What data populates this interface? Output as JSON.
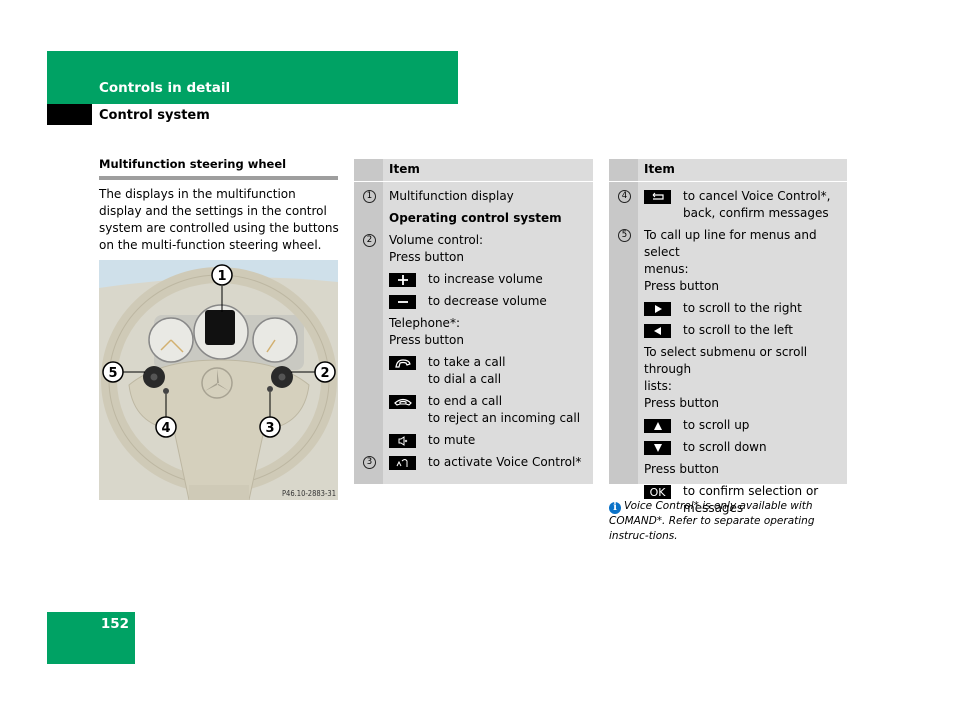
{
  "header": {
    "section_title": "Controls in detail",
    "subsection_title": "Control system"
  },
  "left": {
    "heading": "Multifunction steering wheel",
    "intro": "The displays in the multifunction display and the settings in the control system are controlled using the buttons on the multi-function steering wheel.",
    "figure": {
      "code": "P46.10-2883-31",
      "callouts": [
        "1",
        "2",
        "3",
        "4",
        "5"
      ]
    }
  },
  "table1": {
    "header": "Item",
    "rows": [
      {
        "num": "1",
        "text": "Multifunction display"
      },
      {
        "text": "Operating control system",
        "bold": true
      },
      {
        "num": "2",
        "lines": [
          "Volume control:",
          "Press button"
        ]
      },
      {
        "icon": "plus-key",
        "text": "to increase volume"
      },
      {
        "icon": "minus-key",
        "text": "to decrease volume"
      },
      {
        "lines": [
          "Telephone*:",
          "Press button"
        ]
      },
      {
        "icon": "phone-pickup-key",
        "lines": [
          "to take a call",
          "to dial a call"
        ]
      },
      {
        "icon": "phone-hangup-key",
        "lines": [
          "to end a call",
          "to reject an incoming call"
        ]
      },
      {
        "icon": "mute-key",
        "text": "to mute"
      },
      {
        "num": "3",
        "icon": "voice-control-key",
        "text": "to activate Voice Control*"
      }
    ]
  },
  "table2": {
    "header": "Item",
    "rows": [
      {
        "num": "4",
        "icon": "back-key",
        "lines": [
          "to cancel Voice Control*,",
          "back, confirm messages"
        ]
      },
      {
        "num": "5",
        "lines": [
          "To call up line for menus and select",
          "menus:",
          "Press button"
        ]
      },
      {
        "icon": "right-arrow-key",
        "text": "to scroll to the right"
      },
      {
        "icon": "left-arrow-key",
        "text": "to scroll to the left"
      },
      {
        "lines": [
          "To select submenu or scroll through",
          "lists:",
          "Press button"
        ]
      },
      {
        "icon": "up-arrow-key",
        "text": "to scroll up"
      },
      {
        "icon": "down-arrow-key",
        "text": "to scroll down"
      },
      {
        "text": "Press button"
      },
      {
        "icon": "ok-key",
        "key_label": "OK",
        "lines": [
          "to confirm selection or",
          "messages"
        ]
      }
    ]
  },
  "note": {
    "icon": "info-icon",
    "text": "Voice Control* is only available with COMAND*. Refer to separate operating instruc-tions."
  },
  "footer": {
    "page_number": "152"
  },
  "colors": {
    "brand_green": "#00a264",
    "table_bg": "#dcdcdc",
    "table_num_col": "#c8c8c8"
  }
}
